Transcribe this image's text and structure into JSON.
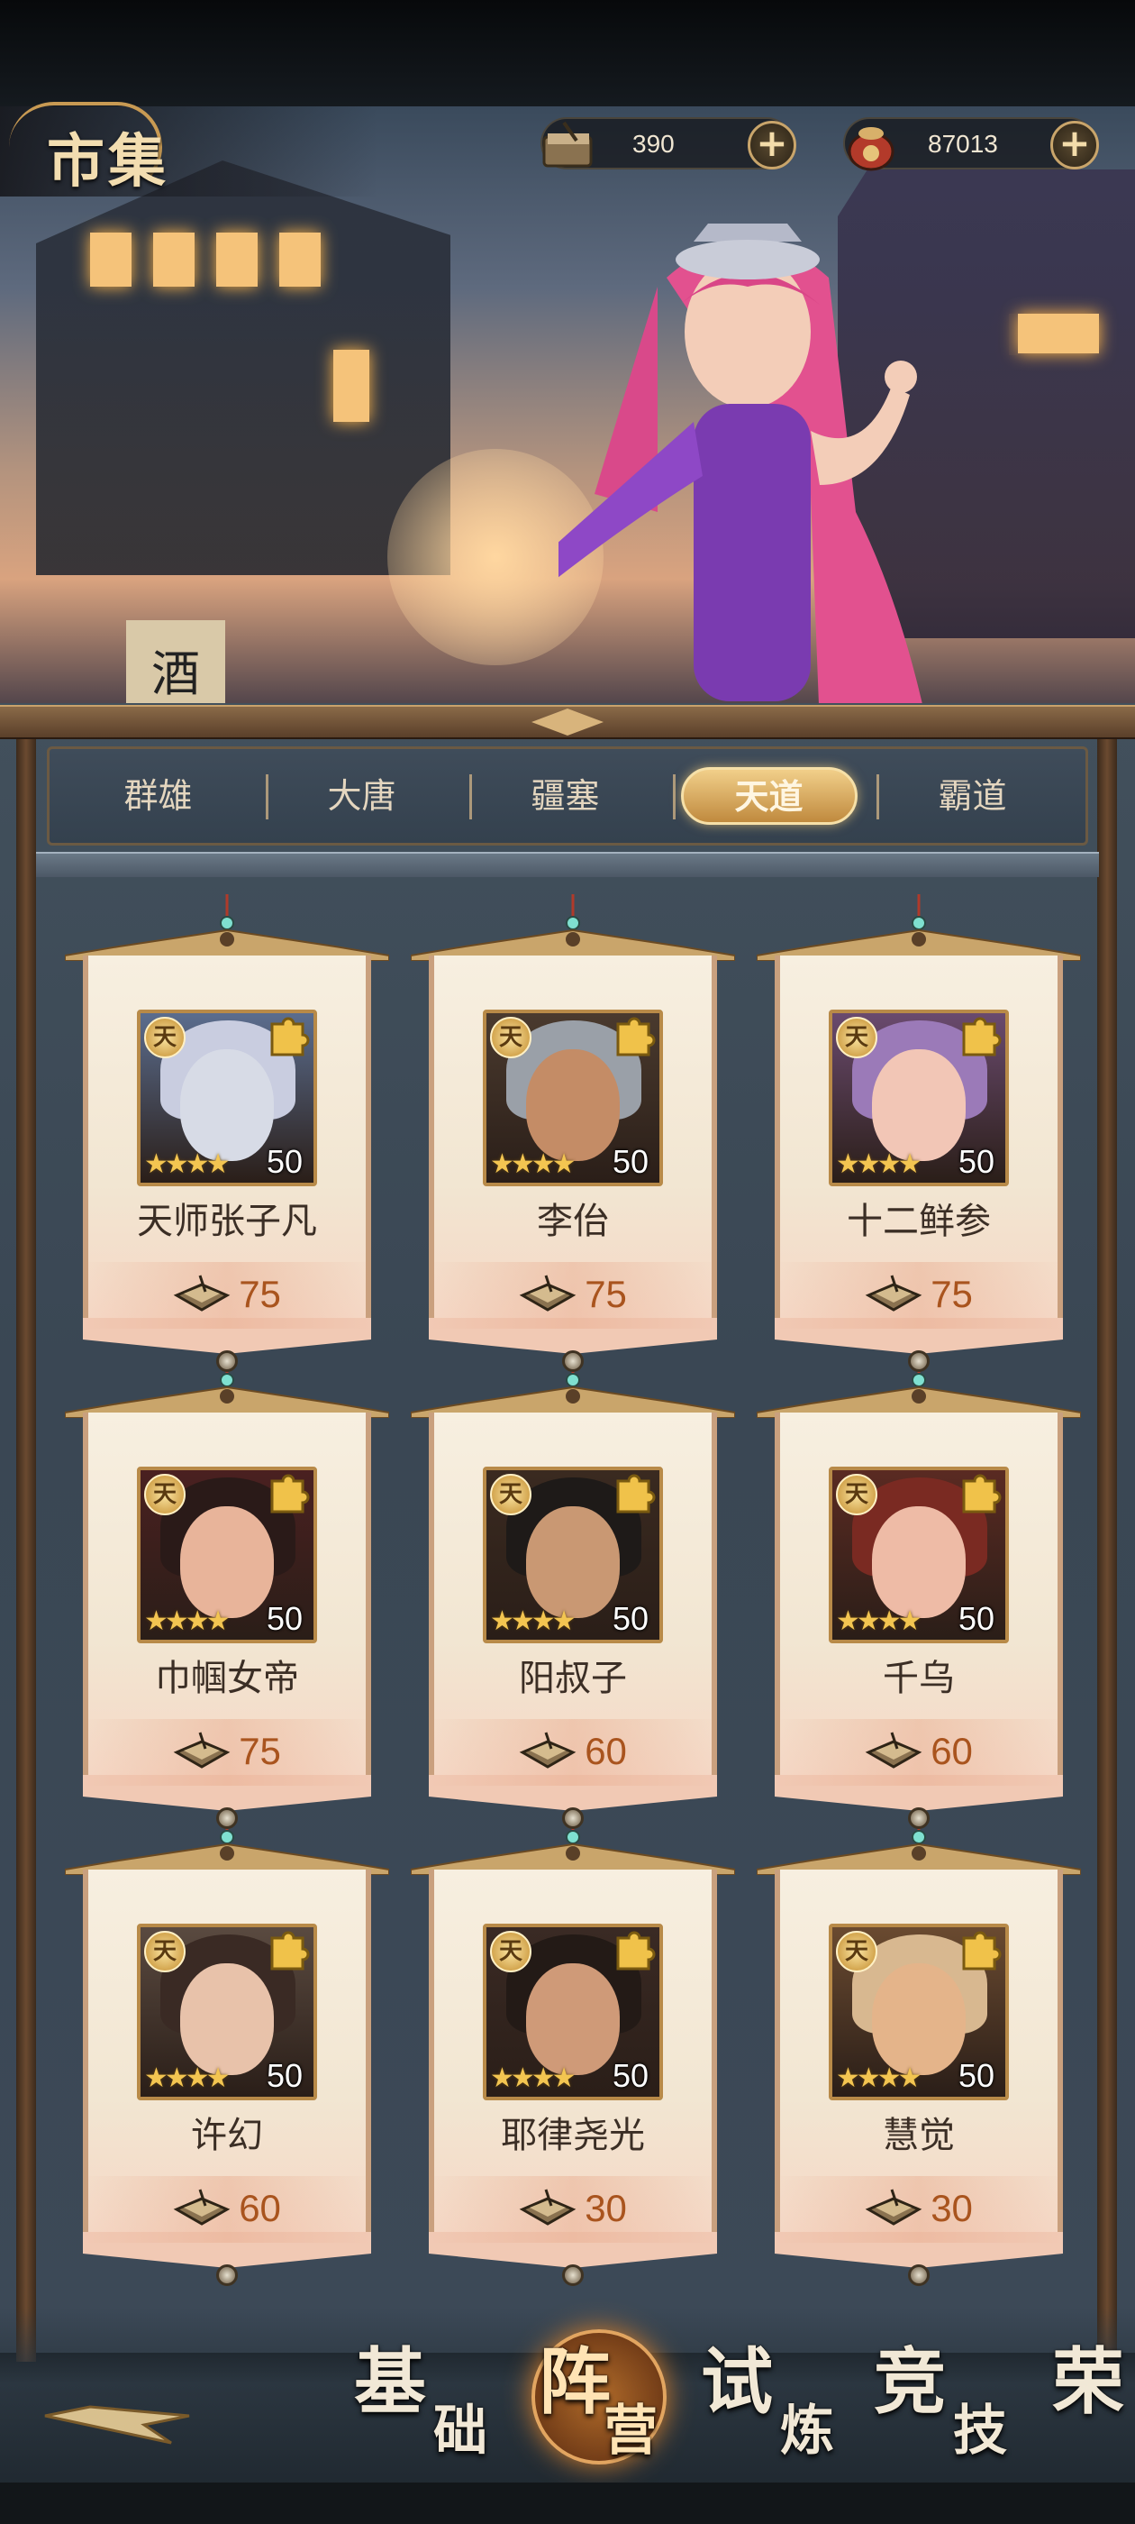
{
  "header": {
    "title": "市集",
    "resources": [
      {
        "icon": "scroll-token-icon",
        "amount": "390"
      },
      {
        "icon": "coin-pouch-icon",
        "amount": "87013"
      }
    ],
    "add_symbol": "+"
  },
  "banner": {
    "sign_text": "酒"
  },
  "tabs": [
    {
      "label": "群雄",
      "active": false
    },
    {
      "label": "大唐",
      "active": false
    },
    {
      "label": "疆塞",
      "active": false
    },
    {
      "label": "天道",
      "active": true
    },
    {
      "label": "霸道",
      "active": false
    }
  ],
  "cards": [
    {
      "name": "天师张子凡",
      "badge": "天",
      "level": "50",
      "price": "75",
      "stars": "★★★★"
    },
    {
      "name": "李佁",
      "badge": "天",
      "level": "50",
      "price": "75",
      "stars": "★★★★"
    },
    {
      "name": "十二鲜参",
      "badge": "天",
      "level": "50",
      "price": "75",
      "stars": "★★★★"
    },
    {
      "name": "巾帼女帝",
      "badge": "天",
      "level": "50",
      "price": "75",
      "stars": "★★★★"
    },
    {
      "name": "阳叔子",
      "badge": "天",
      "level": "50",
      "price": "60",
      "stars": "★★★★"
    },
    {
      "name": "千乌",
      "badge": "天",
      "level": "50",
      "price": "60",
      "stars": "★★★★"
    },
    {
      "name": "许幻",
      "badge": "天",
      "level": "50",
      "price": "60",
      "stars": "★★★★"
    },
    {
      "name": "耶律尧光",
      "badge": "天",
      "level": "50",
      "price": "30",
      "stars": "★★★★"
    },
    {
      "name": "慧觉",
      "badge": "天",
      "level": "50",
      "price": "30",
      "stars": "★★★★"
    }
  ],
  "bottom_nav": [
    {
      "c1": "基",
      "c2": "础",
      "active": false
    },
    {
      "c1": "阵",
      "c2": "营",
      "active": true
    },
    {
      "c1": "试",
      "c2": "炼",
      "active": false
    },
    {
      "c1": "竞",
      "c2": "技",
      "active": false
    },
    {
      "c1": "荣",
      "c2": "",
      "active": false
    }
  ],
  "colors": {
    "gold": "#c9a56b",
    "price": "#a9541e",
    "active_tab": "#e8b965"
  }
}
